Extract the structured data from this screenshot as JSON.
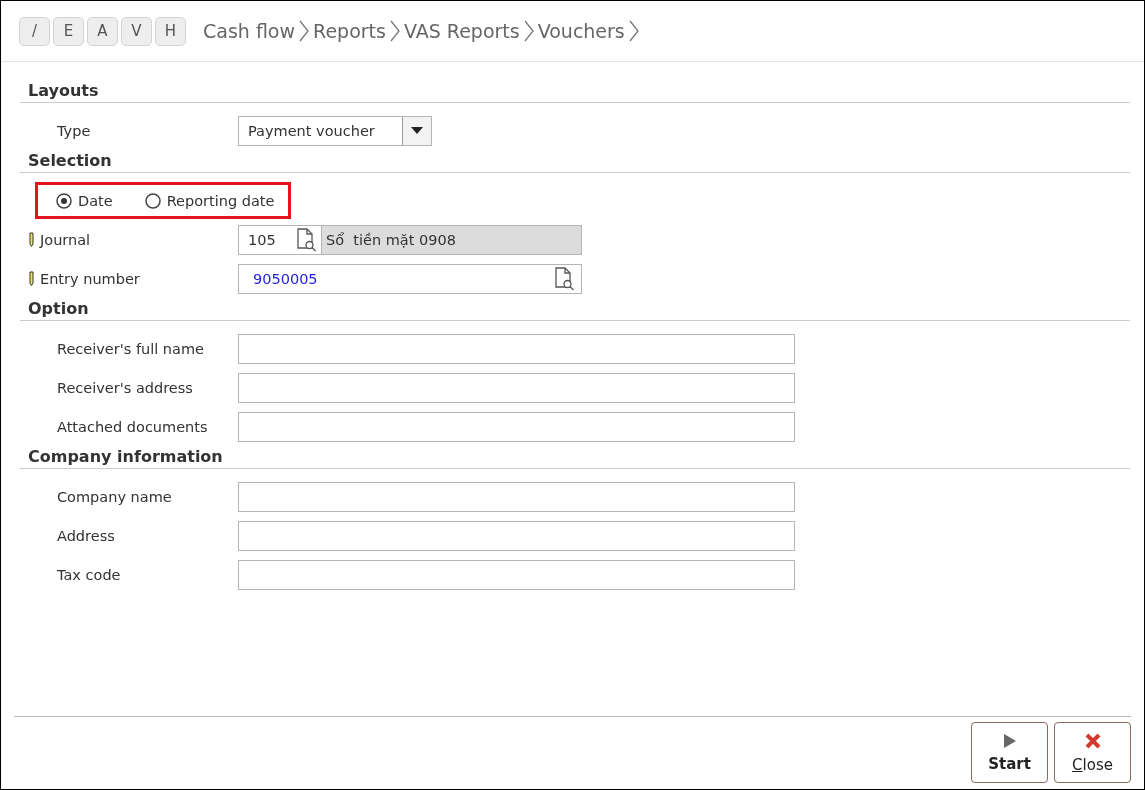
{
  "toolbar": {
    "mode_buttons": [
      "/",
      "E",
      "A",
      "V",
      "H"
    ],
    "breadcrumb": [
      "Cash flow",
      "Reports",
      "VAS Reports",
      "Vouchers"
    ]
  },
  "sections": [
    {
      "title": "Layouts",
      "rows": [
        {
          "kind": "dropdown",
          "label": "Type",
          "value": "Payment voucher"
        }
      ]
    },
    {
      "title": "Selection",
      "rows": [
        {
          "kind": "radios",
          "highlighted": true,
          "options": [
            {
              "label": "Date",
              "selected": true
            },
            {
              "label": "Reporting date",
              "selected": false
            }
          ]
        },
        {
          "kind": "lookup",
          "label": "Journal",
          "required": true,
          "value": "105",
          "description": "Sổ  tiền mặt 0908"
        },
        {
          "kind": "lookup",
          "label": "Entry number",
          "required": true,
          "value": "9050005"
        }
      ]
    },
    {
      "title": "Option",
      "rows": [
        {
          "kind": "text",
          "label": "Receiver's full name"
        },
        {
          "kind": "text",
          "label": "Receiver's address"
        },
        {
          "kind": "text",
          "label": "Attached documents"
        }
      ]
    },
    {
      "title": "Company information",
      "rows": [
        {
          "kind": "text",
          "label": "Company name"
        },
        {
          "kind": "text",
          "label": "Address"
        },
        {
          "kind": "text",
          "label": "Tax code"
        }
      ]
    }
  ],
  "actions": [
    {
      "kind": "start",
      "label": "Start"
    },
    {
      "kind": "close",
      "label": "Close",
      "mnemonic_underlined": true
    }
  ]
}
